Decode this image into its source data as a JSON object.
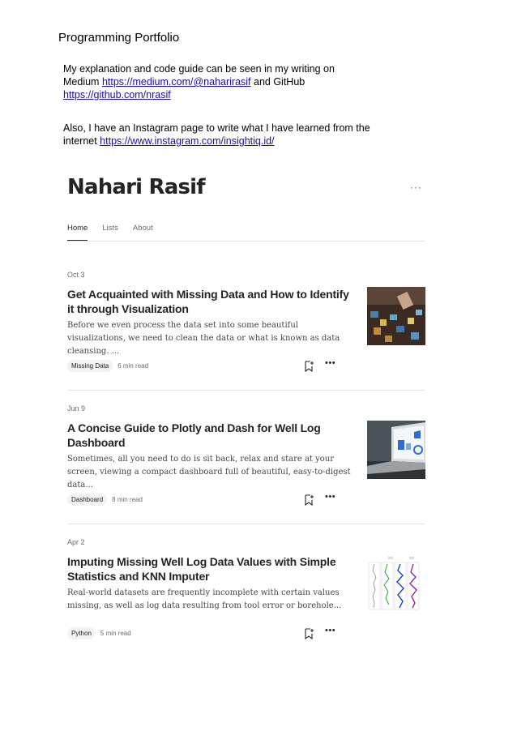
{
  "doc": {
    "title": "Programming Portfolio",
    "para1": {
      "text1": "My explanation and code guide can be seen in my writing on Medium ",
      "medium_link": "https://medium.com/@naharirasif",
      "text2": " and GitHub ",
      "github_link": "https://github.com/nrasif"
    },
    "para2": {
      "text1": "Also, I have an Instagram page to write what I have learned from the internet ",
      "instagram_link": "https://www.instagram.com/insightiq.id/"
    }
  },
  "profile": {
    "name": "Nahari Rasif",
    "more": "···",
    "tabs": [
      "Home",
      "Lists",
      "About"
    ],
    "active_tab": "Home"
  },
  "posts": [
    {
      "date": "Oct 3",
      "title": "Get Acquainted with Missing Data and How to Identify it through Visualization",
      "excerpt": "Before we even process the data set into some beautiful visualizations, we need to clean the data or what is known as data cleansing. ...",
      "tag": "Missing Data",
      "read_time": "6 min read",
      "thumb_icon": "puzzle-photo"
    },
    {
      "date": "Jun 9",
      "title": "A Concise Guide to Plotly and Dash for Well Log Dashboard",
      "excerpt": "Sometimes, all you need to do is sit back, relax and stare at your screen, viewing a compact dashboard full of beautiful, easy-to-digest data...",
      "tag": "Dashboard",
      "read_time": "8 min read",
      "thumb_icon": "laptop-dashboard-photo"
    },
    {
      "date": "Apr 2",
      "title": "Imputing Missing Well Log Data Values with Simple Statistics and KNN Imputer",
      "excerpt": "Real-world datasets are frequently incomplete with certain values missing, as well as log data resulting from tool error or borehole...",
      "tag": "Python",
      "read_time": "5 min read",
      "thumb_icon": "well-log-plot"
    }
  ],
  "colors": {
    "link": "#1a0dab",
    "text_dark": "#242424",
    "text_muted": "#6b6b6b",
    "tag_bg": "#f2f2f2",
    "divider": "#e6e6e6"
  }
}
